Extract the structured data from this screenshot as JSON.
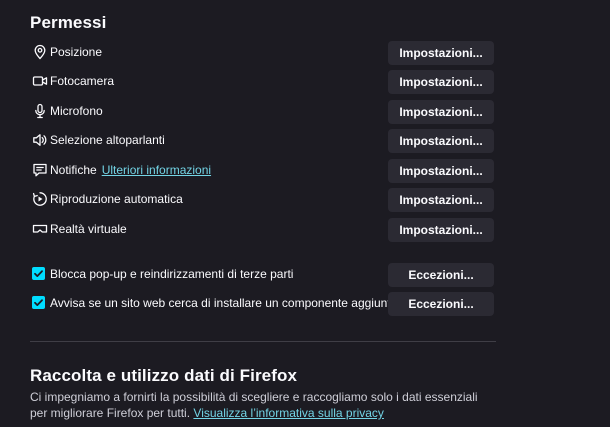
{
  "permissions": {
    "title": "Permessi",
    "items": [
      {
        "icon": "location-pin-icon",
        "label": "Posizione",
        "button": "Impostazioni..."
      },
      {
        "icon": "camera-icon",
        "label": "Fotocamera",
        "button": "Impostazioni..."
      },
      {
        "icon": "microphone-icon",
        "label": "Microfono",
        "button": "Impostazioni..."
      },
      {
        "icon": "speaker-icon",
        "label": "Selezione altoparlanti",
        "button": "Impostazioni..."
      },
      {
        "icon": "notification-icon",
        "label": "Notifiche",
        "link": "Ulteriori informazioni",
        "button": "Impostazioni..."
      },
      {
        "icon": "autoplay-icon",
        "label": "Riproduzione automatica",
        "button": "Impostazioni..."
      },
      {
        "icon": "vr-headset-icon",
        "label": "Realtà virtuale",
        "button": "Impostazioni..."
      }
    ],
    "checkboxes": [
      {
        "label": "Blocca pop-up e reindirizzamenti di terze parti",
        "checked": true,
        "button": "Eccezioni..."
      },
      {
        "label": "Avvisa se un sito web cerca di installare un componente aggiuntivo",
        "checked": true,
        "button": "Eccezioni..."
      }
    ]
  },
  "data_collection": {
    "title": "Raccolta e utilizzo dati di Firefox",
    "description": "Ci impegniamo a fornirti la possibilità di scegliere e raccogliamo solo i dati essenziali per migliorare Firefox per tutti.",
    "link": "Visualizza l’informativa sulla privacy"
  },
  "colors": {
    "background": "#1c1b22",
    "button": "#2b2a33",
    "accent": "#00ddff",
    "link": "#73d5e6"
  }
}
